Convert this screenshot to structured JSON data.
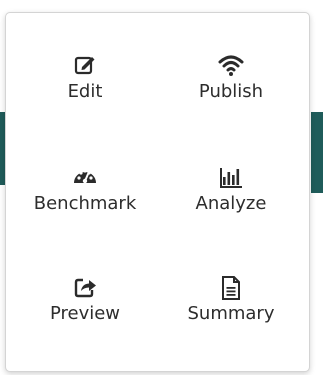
{
  "menu": {
    "items": [
      {
        "label": "Edit",
        "icon": "edit-icon"
      },
      {
        "label": "Publish",
        "icon": "wifi-icon"
      },
      {
        "label": "Benchmark",
        "icon": "dashboard-icon"
      },
      {
        "label": "Analyze",
        "icon": "bar-chart-icon"
      },
      {
        "label": "Preview",
        "icon": "share-icon"
      },
      {
        "label": "Summary",
        "icon": "document-icon"
      }
    ]
  },
  "colors": {
    "accent_bar": "#1f5c5a",
    "text": "#2d2d2d",
    "border": "#d4d4d4"
  }
}
